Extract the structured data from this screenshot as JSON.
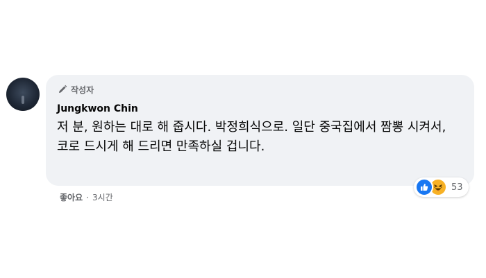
{
  "comment": {
    "badge_label": "작성자",
    "author": "Jungkwon Chin",
    "text": "저 분, 원하는 대로 해 줍시다. 박정희식으로. 일단 중국집에서 짬뽕 시켜서, 코로 드시게 해 드리면 만족하실 겁니다.",
    "like_label": "좋아요",
    "separator": "·",
    "timestamp": "3시간",
    "reaction_count": "53",
    "reactions": [
      "like-icon",
      "haha-icon"
    ]
  },
  "colors": {
    "bubble": "#f0f2f5",
    "like_blue": "#1877f2",
    "haha_yellow": "#f7b125",
    "secondary_text": "#65676b"
  }
}
